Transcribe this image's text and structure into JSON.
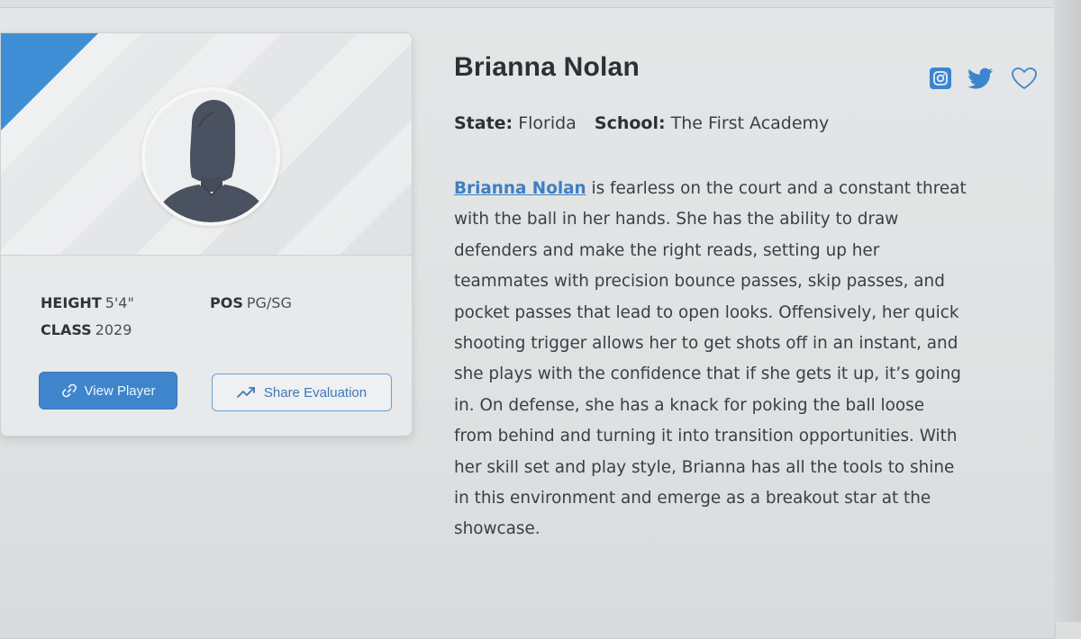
{
  "player": {
    "name": "Brianna Nolan",
    "state_label": "State:",
    "state_value": "Florida",
    "school_label": "School:",
    "school_value": "The First Academy"
  },
  "stats": {
    "height_label": "HEIGHT",
    "height_value": "5'4\"",
    "class_label": "CLASS",
    "class_value": "2029",
    "pos_label": "POS",
    "pos_value": "PG/SG"
  },
  "buttons": {
    "view_player": "View Player",
    "share_evaluation": "Share Evaluation"
  },
  "social_icons": [
    "instagram-icon",
    "twitter-icon",
    "heart-icon"
  ],
  "bio": {
    "link_text": "Brianna Nolan",
    "line1_rest": " is fearless on the court and a constant threat",
    "lines": [
      "with the ball in her hands. She has the ability to draw",
      "defenders and make the right reads, setting up her",
      "teammates with precision bounce passes, skip passes, and",
      "pocket passes that lead to open looks. Offensively, her quick",
      "shooting trigger allows her to get shots off in an instant, and",
      "she plays with the confidence that if she gets it up, it’s going",
      "in. On defense, she has a knack for poking the ball loose",
      "from behind and turning it into transition opportunities. With",
      "her skill set and play style, Brianna has all the tools to shine",
      "in this environment and emerge as a breakout star at the",
      "showcase."
    ]
  },
  "colors": {
    "accent": "#3f85cc",
    "ribbon": "#3f8fd6",
    "link": "#3d7fc2",
    "avatar_silhouette": "#4a5160"
  }
}
